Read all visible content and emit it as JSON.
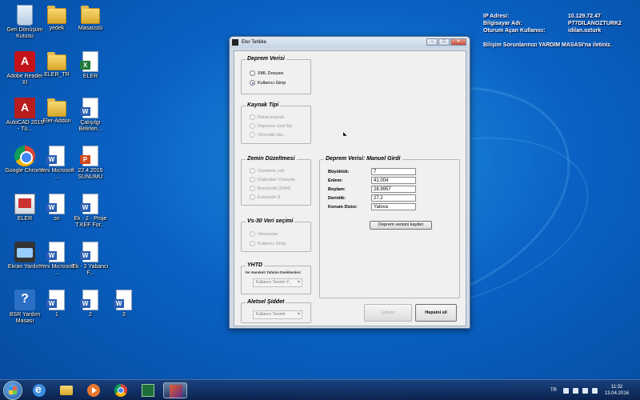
{
  "desktop": {
    "icons": [
      {
        "label": "Geri Dönüşüm Kutusu",
        "icon": "recycle-bin-icon"
      },
      {
        "label": "yedek",
        "icon": "folder-icon"
      },
      {
        "label": "Masaüstü",
        "icon": "folder-icon"
      },
      {
        "label": "Adobe Reader XI",
        "icon": "pdf-icon"
      },
      {
        "label": "ELER_TR",
        "icon": "folder-icon"
      },
      {
        "label": "ELER",
        "icon": "excel-icon"
      },
      {
        "label": "AutoCAD 2015 - Tü...",
        "icon": "autocad-icon"
      },
      {
        "label": "Eler-Addon",
        "icon": "folder-icon"
      },
      {
        "label": "Çalışılgı Belirlen...",
        "icon": "word-icon"
      },
      {
        "label": "Google Chrome",
        "icon": "chrome-icon"
      },
      {
        "label": "Yeni Microsoft ...",
        "icon": "word-icon"
      },
      {
        "label": "22.4.2015 SUNUMU",
        "icon": "powerpoint-icon"
      },
      {
        "label": "ELER",
        "icon": "app-icon"
      },
      {
        "label": "sn",
        "icon": "word-icon"
      },
      {
        "label": "Ek - 2 - Proje T.KEF For...",
        "icon": "word-icon"
      },
      {
        "label": "Ekran Yardım",
        "icon": "screenshot-icon"
      },
      {
        "label": "Yeni Microsoft ...",
        "icon": "word-icon"
      },
      {
        "label": "Ek - 2 Yabancı F...",
        "icon": "word-icon"
      },
      {
        "label": "BSR Yardım Masası",
        "icon": "help-icon"
      },
      {
        "label": "1",
        "icon": "word-icon"
      },
      {
        "label": "2",
        "icon": "word-icon"
      },
      {
        "label": "3",
        "icon": "word-icon"
      }
    ]
  },
  "info_panel": {
    "ip_key": "IP Adresi:",
    "ip_val": "10.129.72.47",
    "pc_key": "Bilgisayar Adı:",
    "pc_val": "P77DILANOZTURK2",
    "user_key": "Oturum Açan Kullanıcı:",
    "user_val": "idilan.ozturk",
    "message": "Bilişim Sorunlarınızı YARDIM MASASI'na iletiniz."
  },
  "window": {
    "title": "Eler Tehlike",
    "btn_min": "–",
    "btn_max": "□",
    "btn_close": "✕",
    "deprem_verisi": {
      "title": "Deprem Verisi",
      "options": [
        "XML Dosyası",
        "Kullanıcı Girişi"
      ],
      "selected": "Kullanıcı Girişi"
    },
    "kaynak_tipi": {
      "title": "Kaynak Tipi",
      "options": [
        "Nokta kaynak",
        "Depreme özel fay",
        "Otomatik ata..."
      ]
    },
    "zemin": {
      "title": "Zemin Düzeltmesi",
      "options": [
        "Düzeltme yok",
        "Doğrudan Yüzeyde",
        "Borcherdt (1994)",
        "Eurocode 8"
      ]
    },
    "vs30": {
      "title": "Vs-30 Veri seçimi",
      "options": [
        "Varsayılan",
        "Kullanıcı Girişi"
      ]
    },
    "yhtd": {
      "title": "YHTD",
      "subtitle": "Yer Hareketi Tahmin Denklemleri",
      "combo": "Kullanıcı Tanımlı Y..."
    },
    "aletsel": {
      "title": "Aletsel Şiddet",
      "combo": "Kullanıcı Tanımlı"
    },
    "manual": {
      "title": "Deprem Verisi: Manuel Girdi",
      "fields": [
        {
          "label": "Büyüklük:",
          "value": "7"
        },
        {
          "label": "Enlem:",
          "value": "41.004"
        },
        {
          "label": "Boylam:",
          "value": "28.9957"
        },
        {
          "label": "Derinlik:",
          "value": "27.2"
        },
        {
          "label": "Konum Dizisi:",
          "value": "Yalova"
        }
      ],
      "save_button": "Deprem verisini kaydet"
    },
    "run_button": "Çalıştır",
    "clear_button": "Hepsini sil"
  },
  "taskbar": {
    "language": "TR",
    "time": "11:32",
    "date": "13.04.2016"
  }
}
